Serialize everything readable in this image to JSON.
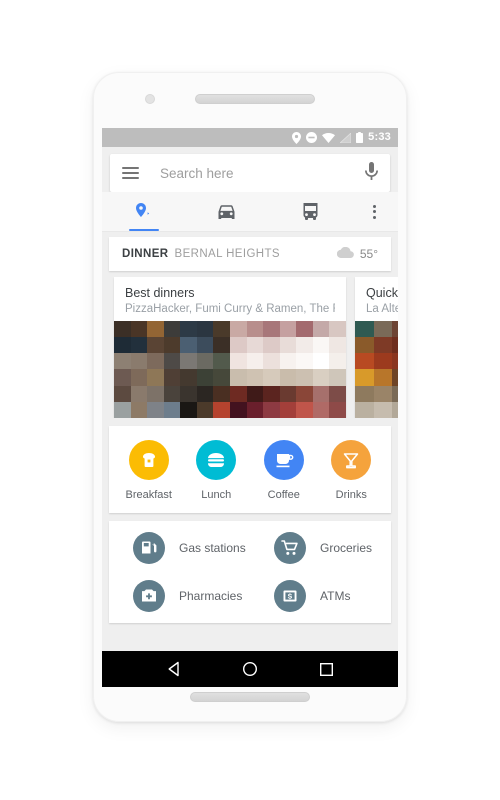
{
  "status_bar": {
    "time": "5:33",
    "icons": [
      "location-pin-icon",
      "do-not-disturb-icon",
      "wifi-icon",
      "cell-signal-icon",
      "battery-icon"
    ]
  },
  "search": {
    "placeholder": "Search here",
    "menu_icon": "hamburger-menu-icon",
    "mic_icon": "microphone-icon"
  },
  "tabs": [
    {
      "name": "explore",
      "icon": "location-pin-icon",
      "active": true
    },
    {
      "name": "driving",
      "icon": "car-icon",
      "active": false
    },
    {
      "name": "transit",
      "icon": "bus-icon",
      "active": false
    },
    {
      "name": "overflow",
      "icon": "more-vertical-icon",
      "active": false
    }
  ],
  "header": {
    "meal": "DINNER",
    "area": "BERNAL HEIGHTS",
    "weather_icon": "cloud-icon",
    "temperature": "55°"
  },
  "place_cards": [
    {
      "title": "Best dinners",
      "subtitle": "PizzaHacker, Fumi Curry & Ramen, The Front…"
    },
    {
      "title": "Quick b",
      "subtitle": "La Alte"
    }
  ],
  "quick_actions": [
    {
      "label": "Breakfast",
      "icon": "toast-icon",
      "color": "#FBBC04"
    },
    {
      "label": "Lunch",
      "icon": "burger-icon",
      "color": "#00BCD4"
    },
    {
      "label": "Coffee",
      "icon": "coffee-cup-icon",
      "color": "#4285F4"
    },
    {
      "label": "Drinks",
      "icon": "cocktail-icon",
      "color": "#F5A33C"
    }
  ],
  "categories": [
    {
      "label": "Gas stations",
      "icon": "gas-pump-icon",
      "color": "#607D8B"
    },
    {
      "label": "Groceries",
      "icon": "shopping-cart-icon",
      "color": "#607D8B"
    },
    {
      "label": "Pharmacies",
      "icon": "pharmacy-icon",
      "color": "#607D8B"
    },
    {
      "label": "ATMs",
      "icon": "atm-icon",
      "color": "#607D8B"
    }
  ],
  "nav_bar": {
    "back": "back-triangle-icon",
    "home": "home-circle-icon",
    "recents": "recents-square-icon"
  },
  "colors": {
    "accent": "#4285F4",
    "status_bar": "#BDBDBD",
    "screen_bg": "#EFEFEF"
  }
}
